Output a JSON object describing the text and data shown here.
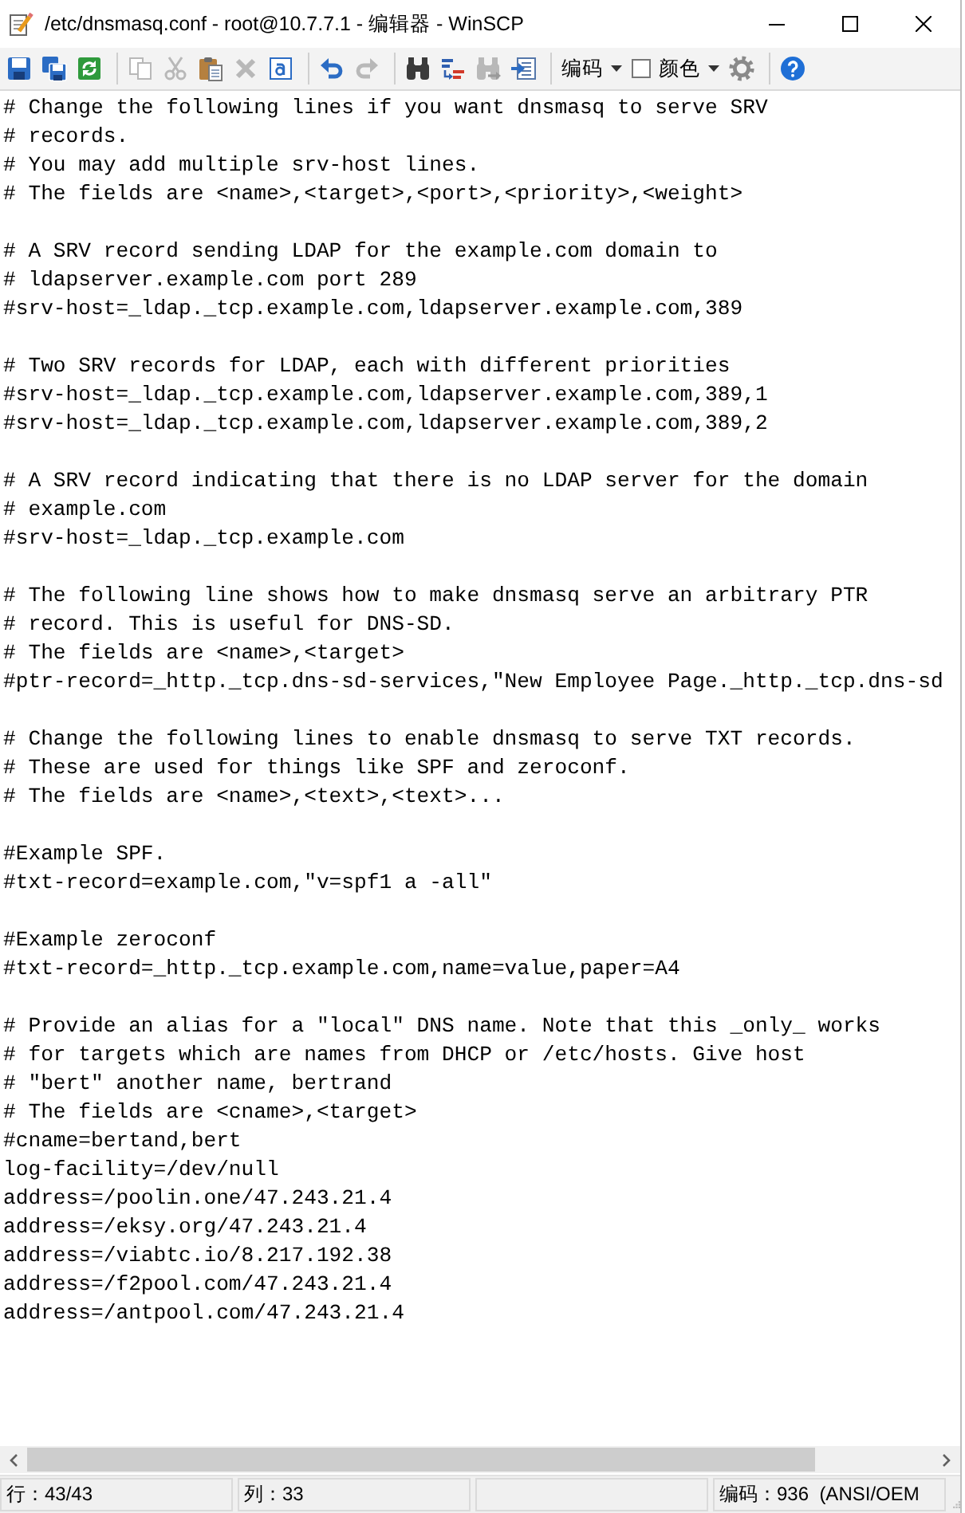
{
  "window": {
    "title": "/etc/dnsmasq.conf - root@10.7.7.1 - 编辑器 - WinSCP"
  },
  "toolbar": {
    "groups": [
      {
        "items": [
          {
            "kind": "save",
            "disabled": false
          },
          {
            "kind": "saveall",
            "disabled": false
          },
          {
            "kind": "reload",
            "disabled": false
          }
        ]
      },
      {
        "items": [
          {
            "kind": "copy",
            "disabled": true
          },
          {
            "kind": "cut",
            "disabled": true
          },
          {
            "kind": "paste",
            "disabled": false
          },
          {
            "kind": "delete",
            "disabled": true
          },
          {
            "kind": "selectall",
            "disabled": false
          }
        ]
      },
      {
        "items": [
          {
            "kind": "undo",
            "disabled": false
          },
          {
            "kind": "redo",
            "disabled": true
          }
        ]
      },
      {
        "items": [
          {
            "kind": "find",
            "disabled": false
          },
          {
            "kind": "replace",
            "disabled": false
          },
          {
            "kind": "findnext",
            "disabled": true
          },
          {
            "kind": "gotoline",
            "disabled": false
          }
        ]
      },
      {
        "items": [
          {
            "kind": "dropdown",
            "label": "编码",
            "disabled": false
          },
          {
            "kind": "color",
            "label": "颜色",
            "disabled": false
          },
          {
            "kind": "settings",
            "disabled": false
          }
        ]
      },
      {
        "items": [
          {
            "kind": "help",
            "disabled": false
          }
        ]
      }
    ]
  },
  "editor": {
    "blocks": [
      {
        "lines": [
          "# Change the following lines if you want dnsmasq to serve SRV",
          "# records.",
          "# You may add multiple srv-host lines.",
          "# The fields are <name>,<target>,<port>,<priority>,<weight>"
        ]
      },
      {
        "lines": [
          "# A SRV record sending LDAP for the example.com domain to",
          "# ldapserver.example.com port 289",
          "#srv-host=_ldap._tcp.example.com,ldapserver.example.com,389"
        ]
      },
      {
        "lines": [
          "# Two SRV records for LDAP, each with different priorities",
          "#srv-host=_ldap._tcp.example.com,ldapserver.example.com,389,1",
          "#srv-host=_ldap._tcp.example.com,ldapserver.example.com,389,2"
        ]
      },
      {
        "lines": [
          "# A SRV record indicating that there is no LDAP server for the domain",
          "# example.com",
          "#srv-host=_ldap._tcp.example.com"
        ]
      },
      {
        "lines": [
          "# The following line shows how to make dnsmasq serve an arbitrary PTR",
          "# record. This is useful for DNS-SD.",
          "# The fields are <name>,<target>",
          "#ptr-record=_http._tcp.dns-sd-services,\"New Employee Page._http._tcp.dns-sd"
        ]
      },
      {
        "lines": [
          "# Change the following lines to enable dnsmasq to serve TXT records.",
          "# These are used for things like SPF and zeroconf.",
          "# The fields are <name>,<text>,<text>..."
        ]
      },
      {
        "lines": [
          "#Example SPF.",
          "#txt-record=example.com,\"v=spf1 a -all\""
        ]
      },
      {
        "lines": [
          "#Example zeroconf",
          "#txt-record=_http._tcp.example.com,name=value,paper=A4"
        ]
      },
      {
        "lines": [
          "# Provide an alias for a \"local\" DNS name. Note that this _only_ works",
          "# for targets which are names from DHCP or /etc/hosts. Give host",
          "# \"bert\" another name, bertrand",
          "# The fields are <cname>,<target>",
          "#cname=bertand,bert",
          "log-facility=/dev/null",
          "address=/poolin.one/47.243.21.4",
          "address=/eksy.org/47.243.21.4",
          "address=/viabtc.io/8.217.192.38",
          "address=/f2pool.com/47.243.21.4",
          "address=/antpool.com/47.243.21.4"
        ]
      }
    ]
  },
  "status_bar": {
    "line": "行：43/43",
    "column": "列：33",
    "encoding": "编码：936  (ANSI/OEM"
  }
}
